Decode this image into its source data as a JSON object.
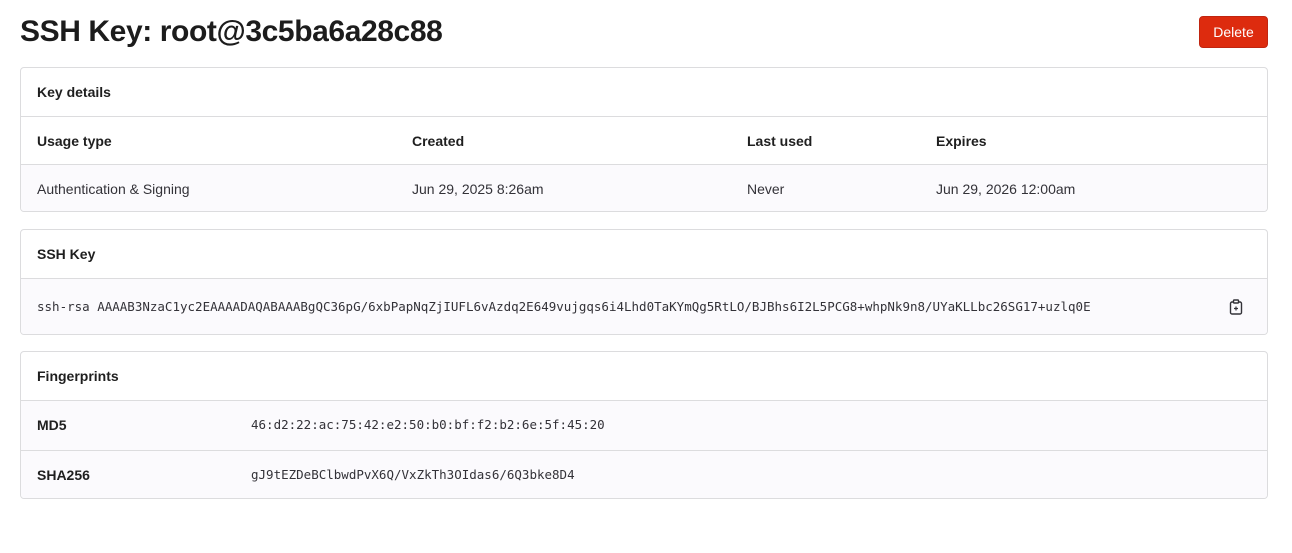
{
  "page": {
    "title": "SSH Key: root@3c5ba6a28c88",
    "delete_label": "Delete"
  },
  "key_details": {
    "header": "Key details",
    "columns": [
      "Usage type",
      "Created",
      "Last used",
      "Expires"
    ],
    "values": [
      "Authentication & Signing",
      "Jun 29, 2025 8:26am",
      "Never",
      "Jun 29, 2026 12:00am"
    ]
  },
  "ssh_key": {
    "header": "SSH Key",
    "value": "ssh-rsa AAAAB3NzaC1yc2EAAAADAQABAAABgQC36pG/6xbPapNqZjIUFL6vAzdq2E649vujgqs6i4Lhd0TaKYmQg5RtLO/BJBhs6I2L5PCG8+whpNk9n8/UYaKLLbc26SG17+uzlq0E",
    "copy_icon": "copy-icon"
  },
  "fingerprints": {
    "header": "Fingerprints",
    "rows": [
      {
        "label": "MD5",
        "value": "46:d2:22:ac:75:42:e2:50:b0:bf:f2:b2:6e:5f:45:20"
      },
      {
        "label": "SHA256",
        "value": "gJ9tEZDeBClbwdPvX6Q/VxZkTh3OIdas6/6Q3bke8D4"
      }
    ]
  },
  "colors": {
    "danger": "#dd2b0e",
    "border": "#dcdcde",
    "row_background": "#fbfafd"
  }
}
